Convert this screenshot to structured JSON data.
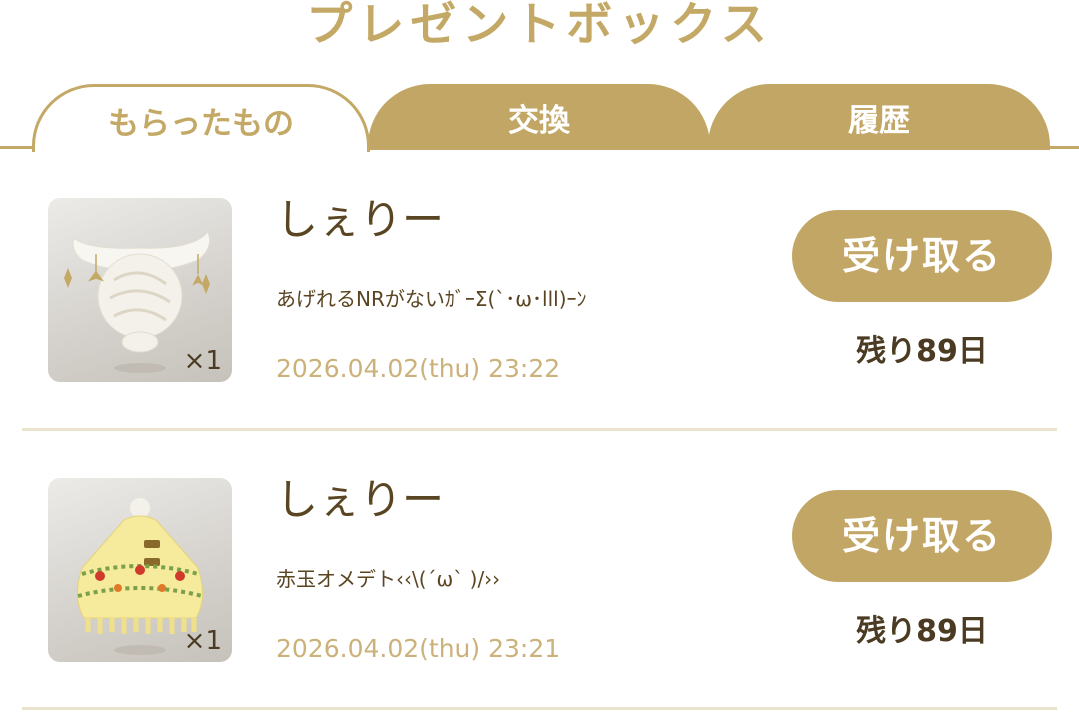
{
  "page": {
    "title": "プレゼントボックス"
  },
  "tabs": [
    {
      "label": "もらったもの",
      "active": true
    },
    {
      "label": "交換",
      "active": false
    },
    {
      "label": "履歴",
      "active": false
    }
  ],
  "items": [
    {
      "sender": "しぇりー",
      "message": "あげれるNRがないｶﾞｰΣ(`･ω･lll)ｰﾝ",
      "date": "2026.04.02(thu) 23:22",
      "quantity": "×1",
      "button_label": "受け取る",
      "remaining": "残り89日",
      "thumbnail_icon": "white-hair-accessory-icon"
    },
    {
      "sender": "しぇりー",
      "message": "赤玉オメデト‹‹\\(´ω` )/››",
      "date": "2026.04.02(thu) 23:21",
      "quantity": "×1",
      "button_label": "受け取る",
      "remaining": "残り89日",
      "thumbnail_icon": "yellow-poncho-icon"
    }
  ],
  "colors": {
    "accent_gold": "#c2a665",
    "title_gold": "#c4a866",
    "text_brown": "#5a4522",
    "date_gold": "#cbb27a",
    "divider": "#ebe4cd"
  }
}
